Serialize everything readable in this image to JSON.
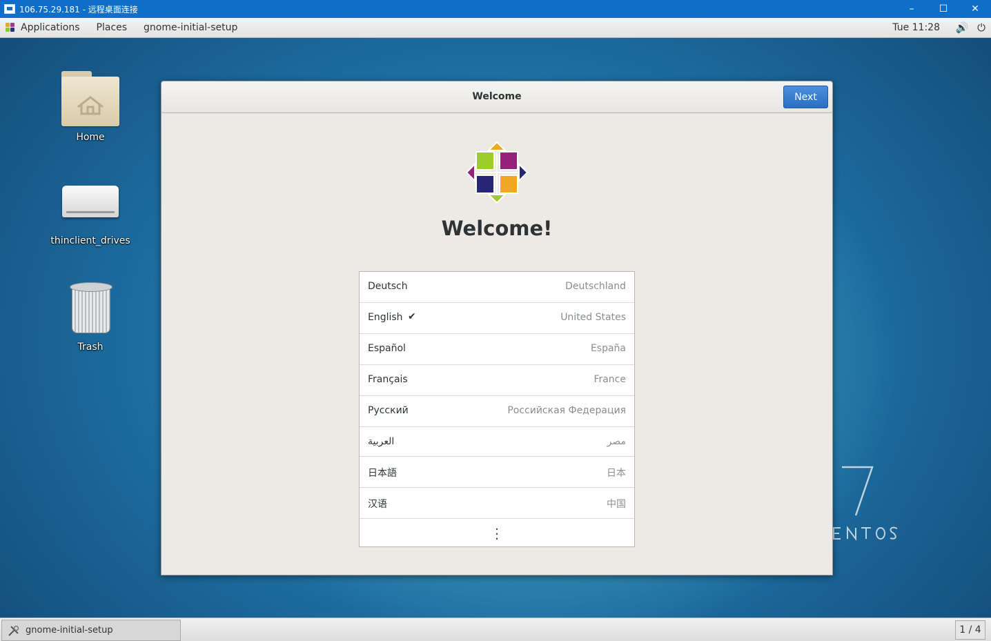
{
  "rdp": {
    "title": "106.75.29.181 - 远程桌面连接",
    "minimize": "–",
    "maximize": "☐",
    "close": "✕"
  },
  "top_panel": {
    "applications": "Applications",
    "places": "Places",
    "active_app": "gnome-initial-setup",
    "clock": "Tue 11:28",
    "volume_icon": "🔊",
    "power_icon": "⏻"
  },
  "desktop": {
    "icons": [
      {
        "label": "Home",
        "icon": "home-folder-icon"
      },
      {
        "label": "thinclient_drives",
        "icon": "drive-icon"
      },
      {
        "label": "Trash",
        "icon": "trash-icon"
      }
    ]
  },
  "window": {
    "title": "Welcome",
    "next_label": "Next",
    "heading": "Welcome!",
    "languages": [
      {
        "name": "Deutsch",
        "region": "Deutschland",
        "selected": false
      },
      {
        "name": "English",
        "region": "United States",
        "selected": true
      },
      {
        "name": "Español",
        "region": "España",
        "selected": false
      },
      {
        "name": "Français",
        "region": "France",
        "selected": false
      },
      {
        "name": "Русский",
        "region": "Российская Федерация",
        "selected": false
      },
      {
        "name": "العربية",
        "region": "مصر",
        "selected": false
      },
      {
        "name": "日本語",
        "region": "日本",
        "selected": false
      },
      {
        "name": "汉语",
        "region": "中国",
        "selected": false
      }
    ],
    "check_glyph": "✔",
    "more_glyph": "⋮"
  },
  "taskbar": {
    "task_label": "gnome-initial-setup",
    "workspace": "1 / 4"
  },
  "colors": {
    "rdp_blue": "#0f6ec9",
    "suggested_action": "#3a80d0"
  }
}
